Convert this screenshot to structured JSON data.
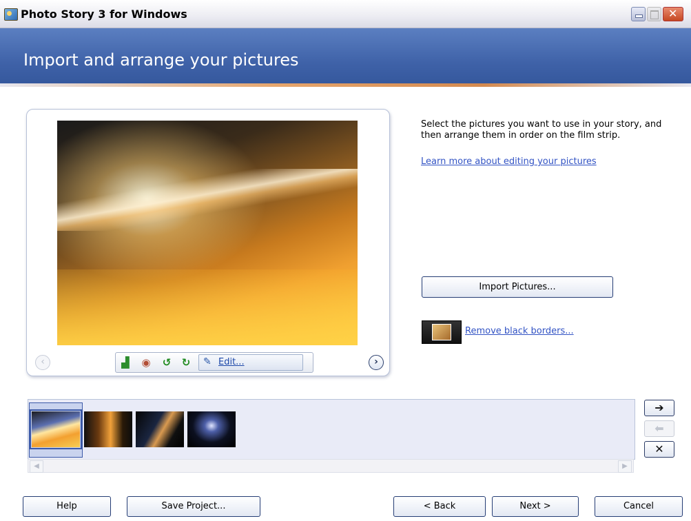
{
  "window": {
    "title": "Photo Story 3 for Windows",
    "controls": {
      "minimize_icon": "minimize-icon",
      "maximize_icon": "maximize-icon",
      "close_icon": "close-icon"
    }
  },
  "header": {
    "title": "Import and arrange your pictures",
    "colors": {
      "band": "#3f62a8",
      "accent": "#d48a4f"
    }
  },
  "preview": {
    "photo_icon": "night-street-light-trails-photo",
    "tools": [
      {
        "icon": "auto-correct-levels-icon"
      },
      {
        "icon": "red-eye-icon"
      },
      {
        "icon": "rotate-left-icon"
      },
      {
        "icon": "rotate-right-icon"
      }
    ],
    "edit_label": "Edit...",
    "prev_icon": "chevron-left-icon",
    "next_icon": "chevron-right-icon"
  },
  "info": {
    "instructions": "Select the pictures you want to use in your story, and then arrange them in order on the film strip.",
    "learn_link": "Learn more about editing your pictures",
    "import_button": "Import Pictures...",
    "remove_borders_link": "Remove black borders..."
  },
  "filmstrip": {
    "thumbnails": [
      {
        "name": "light-trails-street",
        "selected": true
      },
      {
        "name": "night-alley-lights",
        "selected": false
      },
      {
        "name": "building-at-night",
        "selected": false
      },
      {
        "name": "tower-night-sky",
        "selected": false
      }
    ]
  },
  "side_buttons": {
    "move_right_icon": "arrow-right-icon",
    "move_left_icon": "arrow-left-icon",
    "delete_icon": "delete-x-icon"
  },
  "footer": {
    "help": "Help",
    "save": "Save Project...",
    "back": "< Back",
    "next": "Next >",
    "cancel": "Cancel"
  }
}
